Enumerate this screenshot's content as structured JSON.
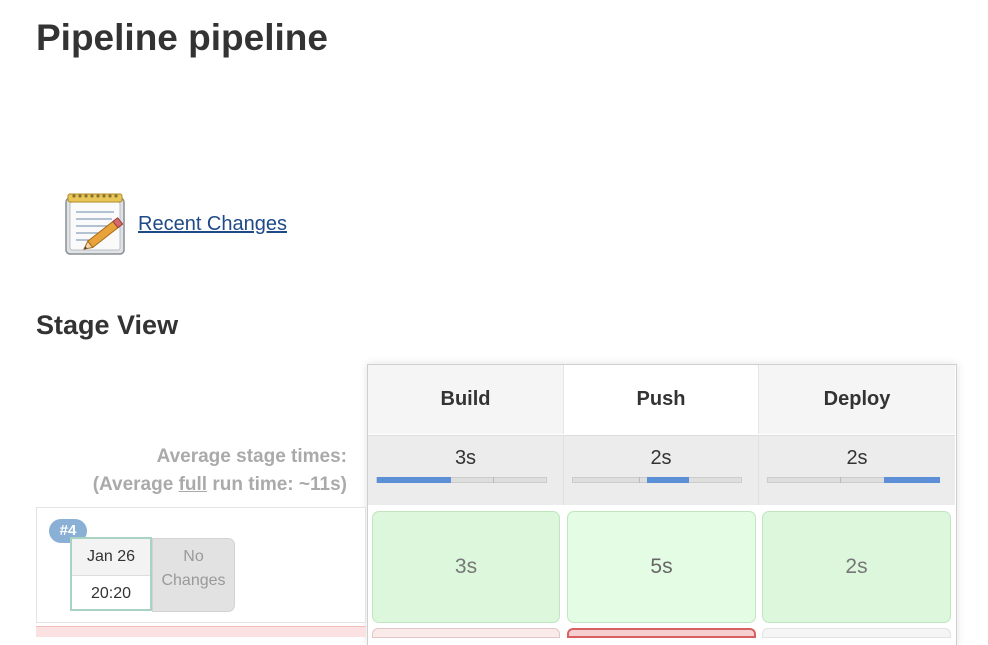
{
  "page": {
    "title": "Pipeline pipeline"
  },
  "recent_changes": {
    "label": "Recent Changes",
    "icon": "notepad-pencil-icon"
  },
  "stage_view": {
    "title": "Stage View",
    "avg_stage_label": "Average stage times:",
    "avg_run_prefix": "(Average ",
    "avg_run_full": "full",
    "avg_run_suffix": " run time: ~11s)",
    "stages": [
      {
        "name": "Build",
        "avg": "3s"
      },
      {
        "name": "Push",
        "avg": "2s"
      },
      {
        "name": "Deploy",
        "avg": "2s"
      }
    ],
    "runs": [
      {
        "badge": "#4",
        "date": "Jan 26",
        "time": "20:20",
        "changes_line1": "No",
        "changes_line2": "Changes",
        "durations": [
          "3s",
          "5s",
          "2s"
        ],
        "status": "success"
      }
    ]
  },
  "colors": {
    "success_cell": "#dcf7dc",
    "failed_border": "#d96060",
    "bar_fill": "#5b8fd6",
    "link": "#204a87"
  }
}
